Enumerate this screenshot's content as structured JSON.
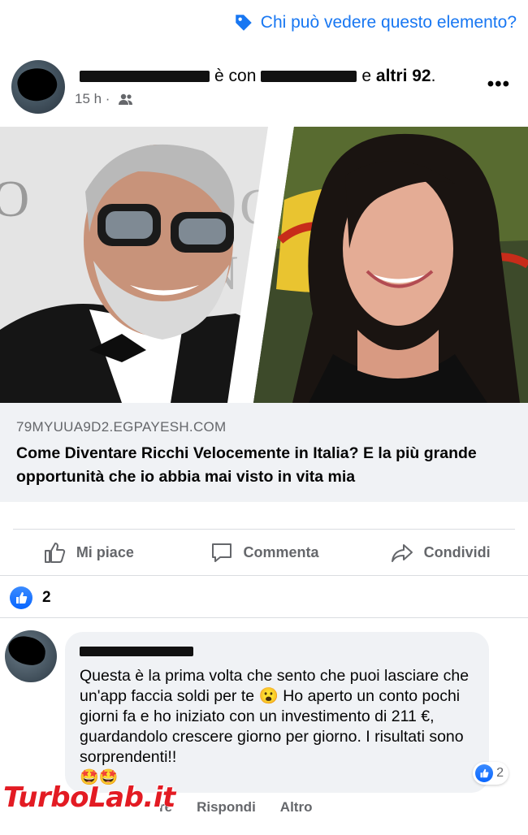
{
  "privacy": {
    "label": "Chi può vedere questo elemento?"
  },
  "post": {
    "with_word": "è con",
    "and_word": "e",
    "others": "altri 92",
    "period": ".",
    "time": "15 h ·",
    "more": "•••"
  },
  "link": {
    "domain": "79MYUUA9D2.EGPAYESH.COM",
    "title": "Come Diventare Ricchi Velocemente in Italia? E la più grande opportunità che io abbia mai visto in vita mia"
  },
  "actions": {
    "like": "Mi piace",
    "comment": "Commenta",
    "share": "Condividi"
  },
  "reactions": {
    "count": "2"
  },
  "comment": {
    "text": "Questa è la prima volta che sento che puoi lasciare che un'app faccia soldi per te 😮 Ho aperto un conto pochi giorni fa e ho iniziato con un investimento di 211 €, guardandolo crescere giorno per giorno. I risultati sono sorprendenti!!",
    "emojis": "🤩🤩",
    "reaction_count": "2",
    "reply": "Rispondi",
    "more": "Altro",
    "like_partial": "re"
  },
  "watermark": {
    "text": "TurboLab.it"
  },
  "colors": {
    "accent": "#1877f2",
    "watermark": "#e31b23"
  }
}
